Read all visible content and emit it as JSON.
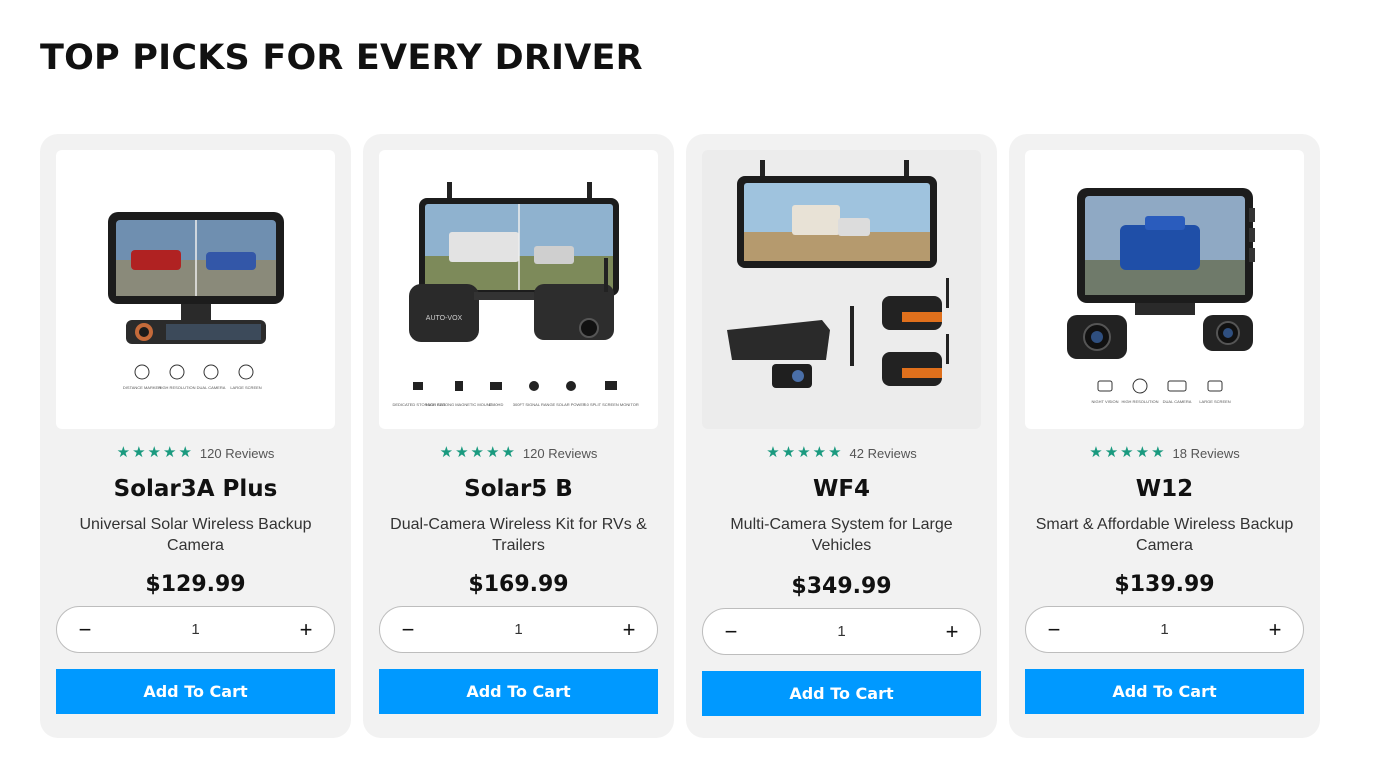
{
  "section": {
    "title": "TOP PICKS FOR EVERY DRIVER"
  },
  "colors": {
    "accent": "#0099ff",
    "star": "#1a9a7f",
    "card_bg": "#f2f2f2"
  },
  "products": [
    {
      "name": "Solar3A Plus",
      "description": "Universal Solar Wireless Backup Camera",
      "reviews": "120 Reviews",
      "rating": 5,
      "price": "$129.99",
      "quantity": "1",
      "add_label": "Add To Cart",
      "features": [
        "DISTANCE MARKER",
        "HIGH RESOLUTION",
        "DUAL CAMERA",
        "LARGE SCREEN"
      ]
    },
    {
      "name": "Solar5 B",
      "description": "Dual-Camera Wireless Kit for RVs & Trailers",
      "reviews": "120 Reviews",
      "rating": 5,
      "price": "$169.99",
      "quantity": "1",
      "add_label": "Add To Cart",
      "brand_on_case": "AUTO-VOX",
      "features": [
        "DEDICATED STORAGE BAG",
        "HIGH STRONG MAGNETIC MOUNT",
        "1080HD",
        "300FT SIGNAL RANGE",
        "SOLAR POWER",
        "7.0 SPLIT SCREEN MONITOR"
      ]
    },
    {
      "name": "WF4",
      "description": "Multi-Camera System for Large Vehicles",
      "reviews": "42 Reviews",
      "rating": 5,
      "price": "$349.99",
      "quantity": "1",
      "add_label": "Add To Cart"
    },
    {
      "name": "W12",
      "description": "Smart & Affordable Wireless Backup Camera",
      "reviews": "18 Reviews",
      "rating": 5,
      "price": "$139.99",
      "quantity": "1",
      "add_label": "Add To Cart",
      "features": [
        "NIGHT VISION",
        "HIGH RESOLUTION",
        "DUAL CAMERA",
        "LARGE SCREEN"
      ]
    }
  ],
  "icons": {
    "decrease": "minus-icon",
    "increase": "plus-icon",
    "star": "star-icon"
  }
}
